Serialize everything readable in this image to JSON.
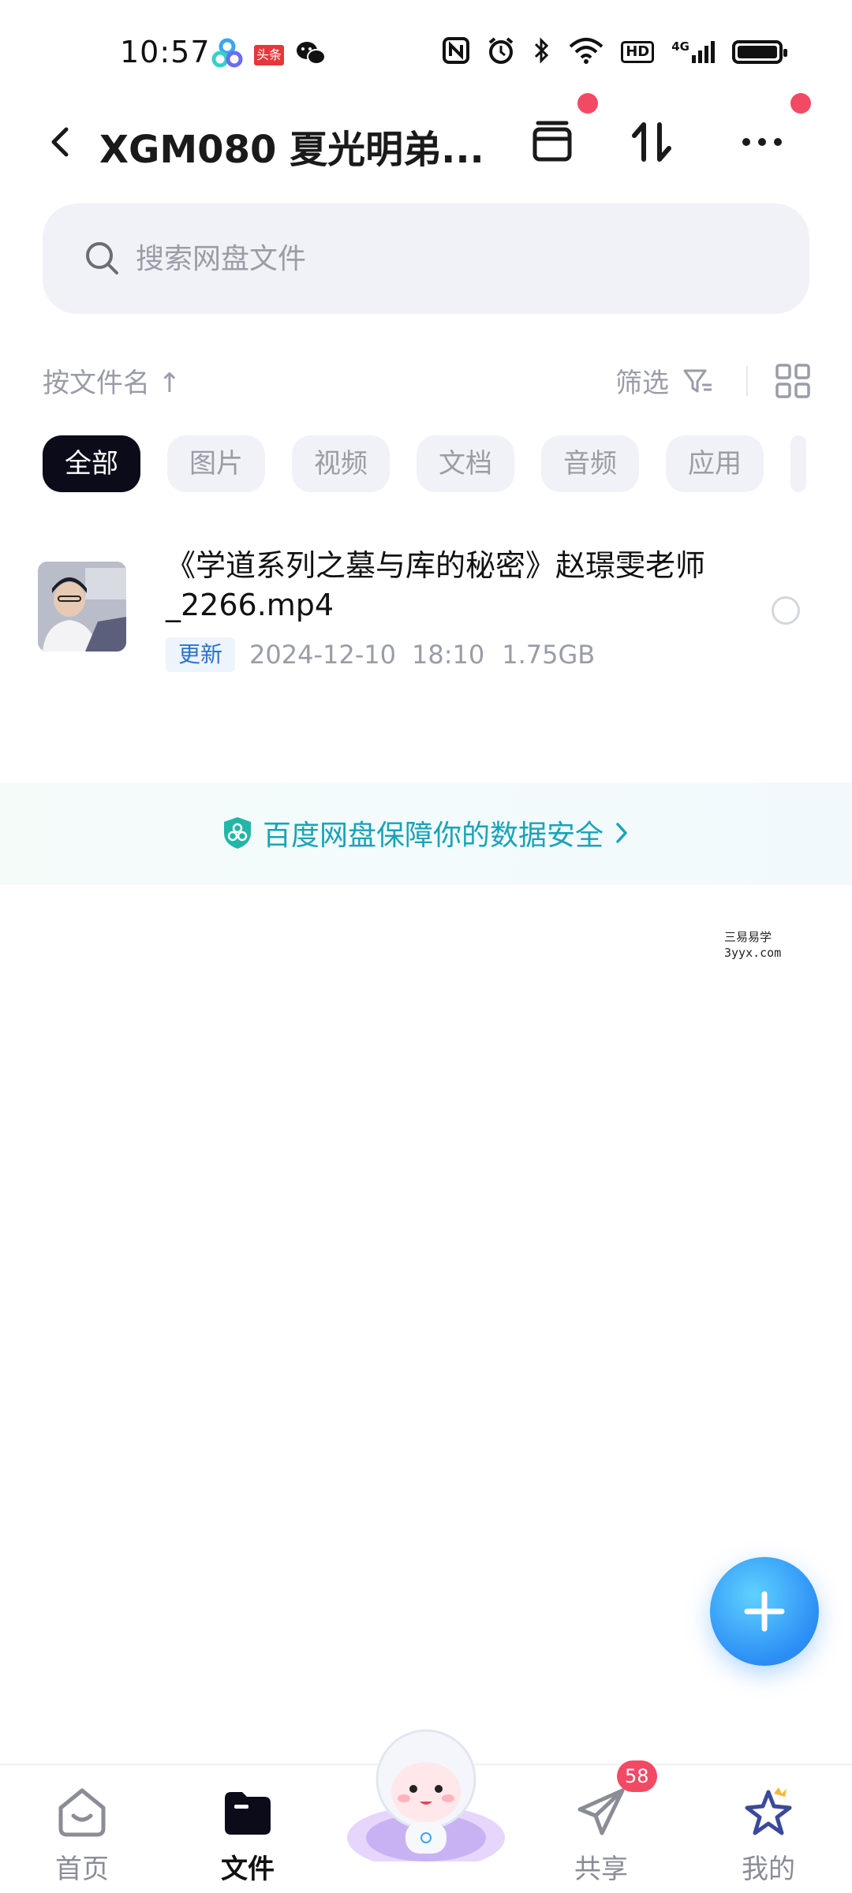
{
  "status_bar": {
    "time": "10:57",
    "app_icons": [
      "baidu-netdisk-icon",
      "toutiao-icon",
      "wechat-icon"
    ],
    "toutiao_label": "头条",
    "system_icons": [
      "nfc-icon",
      "alarm-icon",
      "bluetooth-icon",
      "wifi-icon",
      "hd-icon",
      "signal-4g-icon",
      "battery-icon"
    ],
    "hd_label": "HD",
    "network_label": "4G"
  },
  "header": {
    "title": "XGM080 夏光明弟...",
    "icons": [
      "back-icon",
      "archive-icon",
      "transfer-icon",
      "more-icon"
    ]
  },
  "search": {
    "placeholder": "搜索网盘文件"
  },
  "sort": {
    "label": "按文件名 ↑",
    "filter_label": "筛选"
  },
  "tabs": [
    {
      "label": "全部",
      "active": true
    },
    {
      "label": "图片",
      "active": false
    },
    {
      "label": "视频",
      "active": false
    },
    {
      "label": "文档",
      "active": false
    },
    {
      "label": "音频",
      "active": false
    },
    {
      "label": "应用",
      "active": false
    }
  ],
  "files": [
    {
      "name": "《学道系列之墓与库的秘密》赵璟雯老师_2266.mp4",
      "tag": "更新",
      "date": "2024-12-10",
      "time": "18:10",
      "size": "1.75GB"
    }
  ],
  "banner": {
    "text": "百度网盘保障你的数据安全"
  },
  "watermark": {
    "line1": "三易易学",
    "line2": "3yyx.com"
  },
  "bottom_nav": [
    {
      "label": "首页",
      "icon": "home-icon",
      "active": false
    },
    {
      "label": "文件",
      "icon": "folder-icon",
      "active": true
    },
    {
      "label": "",
      "icon": "mascot-icon",
      "active": false
    },
    {
      "label": "共享",
      "icon": "share-icon",
      "active": false,
      "badge": "58"
    },
    {
      "label": "我的",
      "icon": "profile-icon",
      "active": false
    }
  ],
  "colors": {
    "accent": "#2b8ef5",
    "badge": "#f24a64",
    "banner_text": "#1aa3b8",
    "active_chip": "#0b0b1a"
  }
}
